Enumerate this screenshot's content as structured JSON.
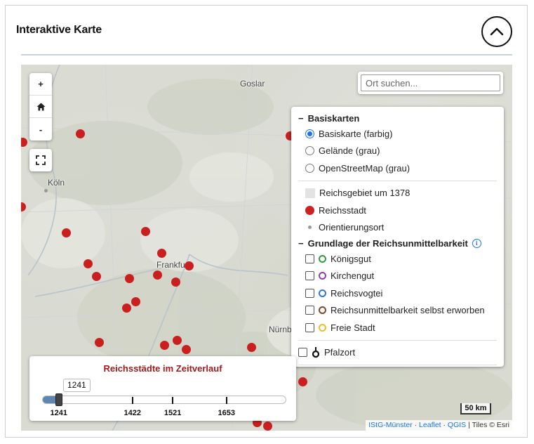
{
  "header": {
    "title": "Interaktive Karte",
    "collapse_icon": "chevron-up-icon"
  },
  "map": {
    "search_placeholder": "Ort suchen...",
    "zoom_in_label": "+",
    "home_icon": "home-icon",
    "zoom_out_label": "-",
    "fullscreen_icon": "fullscreen-icon",
    "place_labels": [
      "Goslar",
      "Köln",
      "Frankfurt",
      "Nürnb"
    ],
    "scale_label": "50 km",
    "attribution": {
      "parts": [
        "IStG-Münster",
        "Leaflet",
        "QGIS"
      ],
      "separator": "·",
      "suffix": "| Tiles © Esri"
    }
  },
  "layers": {
    "basemaps_title": "Basiskarten",
    "basemaps": [
      {
        "label": "Basiskarte (farbig)",
        "checked": true
      },
      {
        "label": "Gelände (grau)",
        "checked": false
      },
      {
        "label": "OpenStreetMap (grau)",
        "checked": false
      }
    ],
    "legend": [
      {
        "label": "Reichsgebiet um 1378",
        "symbol": "grey-square"
      },
      {
        "label": "Reichsstadt",
        "symbol": "red-dot"
      },
      {
        "label": "Orientierungsort",
        "symbol": "grey-dot"
      }
    ],
    "basis_title": "Grundlage der Reichsunmittelbarkeit",
    "basis_items": [
      {
        "label": "Königsgut",
        "color": "#2e9e3a"
      },
      {
        "label": "Kirchengut",
        "color": "#8e3fa8"
      },
      {
        "label": "Reichsvogtei",
        "color": "#2f78d4"
      },
      {
        "label": "Reichsunmittelbarkeit selbst erworben",
        "color": "#7a4a2a"
      },
      {
        "label": "Freie Stadt",
        "color": "#f0c020"
      }
    ],
    "pfalz_label": "Pfalzort",
    "collapse_marker": "−"
  },
  "timeline": {
    "title": "Reichsstädte im Zeitverlauf",
    "current_value": "1241",
    "range": [
      1200,
      1800
    ],
    "ticks": [
      "1241",
      "1422",
      "1521",
      "1653"
    ],
    "colors": {
      "title": "#a31c1c",
      "fill": "#5d86b0"
    }
  },
  "colors": {
    "city_dot": "#c91f1f",
    "accent": "#1a73e8"
  }
}
